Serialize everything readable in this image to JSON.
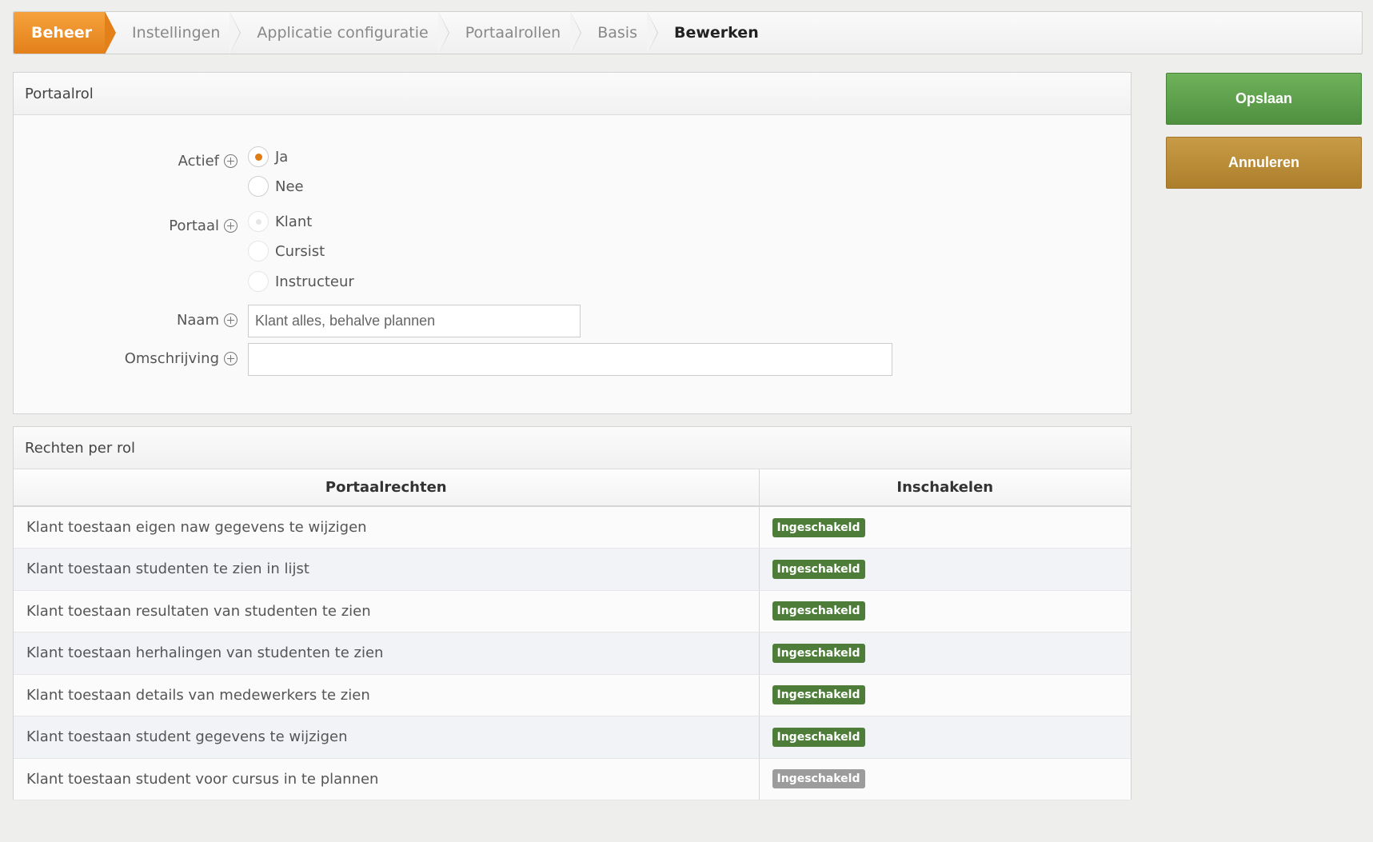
{
  "breadcrumb": [
    "Beheer",
    "Instellingen",
    "Applicatie configuratie",
    "Portaalrollen",
    "Basis",
    "Bewerken"
  ],
  "role_panel": {
    "title": "Portaalrol",
    "actief": {
      "label": "Actief",
      "options": [
        "Ja",
        "Nee"
      ],
      "selected": "Ja"
    },
    "portaal": {
      "label": "Portaal",
      "options": [
        "Klant",
        "Cursist",
        "Instructeur"
      ],
      "selected": "Klant",
      "disabled": true
    },
    "naam": {
      "label": "Naam",
      "value": "Klant alles, behalve plannen"
    },
    "omschrijving": {
      "label": "Omschrijving",
      "value": ""
    }
  },
  "rights_panel": {
    "title": "Rechten per rol",
    "columns": [
      "Portaalrechten",
      "Inschakelen"
    ],
    "rows": [
      {
        "right": "Klant toestaan eigen naw gegevens te wijzigen",
        "status": "Ingeschakeld",
        "enabled": true
      },
      {
        "right": "Klant toestaan studenten te zien in lijst",
        "status": "Ingeschakeld",
        "enabled": true
      },
      {
        "right": "Klant toestaan resultaten van studenten te zien",
        "status": "Ingeschakeld",
        "enabled": true
      },
      {
        "right": "Klant toestaan herhalingen van studenten te zien",
        "status": "Ingeschakeld",
        "enabled": true
      },
      {
        "right": "Klant toestaan details van medewerkers te zien",
        "status": "Ingeschakeld",
        "enabled": true
      },
      {
        "right": "Klant toestaan student gegevens te wijzigen",
        "status": "Ingeschakeld",
        "enabled": true
      },
      {
        "right": "Klant toestaan student voor cursus in te plannen",
        "status": "Ingeschakeld",
        "enabled": false
      }
    ]
  },
  "actions": {
    "save": "Opslaan",
    "cancel": "Annuleren"
  },
  "colors": {
    "accent": "#e3801a",
    "save": "#5ea04c",
    "cancel": "#b98a36",
    "badge_on": "#4e7d3a",
    "badge_off": "#9c9c9c"
  }
}
